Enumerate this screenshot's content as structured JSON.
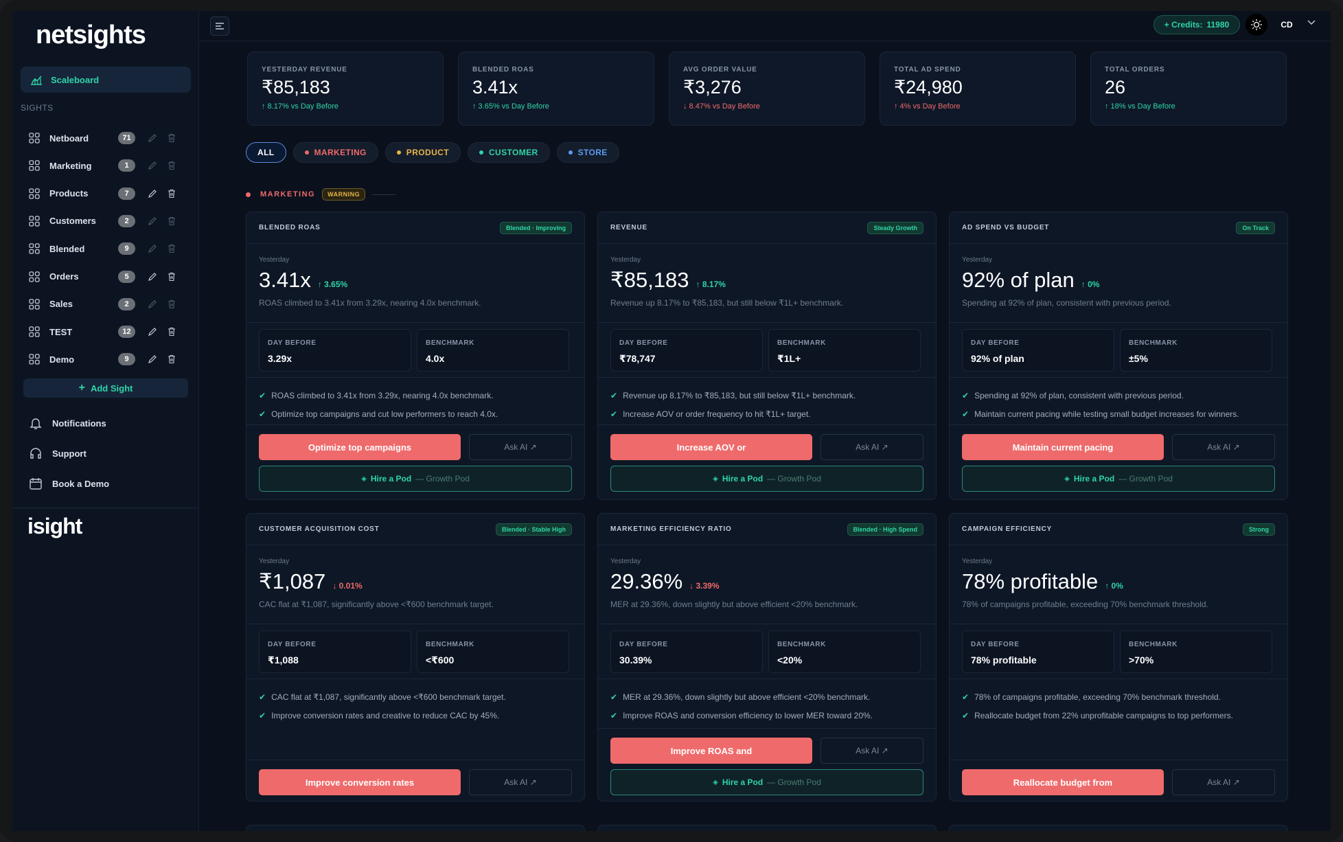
{
  "brand": {
    "logo": "netsights",
    "logo2": "isight"
  },
  "sidebar": {
    "active_item": "Scaleboard",
    "section_label": "SIGHTS",
    "sights": [
      {
        "label": "Netboard",
        "count": "71"
      },
      {
        "label": "Marketing",
        "count": "1"
      },
      {
        "label": "Products",
        "count": "7"
      },
      {
        "label": "Customers",
        "count": "2"
      },
      {
        "label": "Blended",
        "count": "9"
      },
      {
        "label": "Orders",
        "count": "5"
      },
      {
        "label": "Sales",
        "count": "2"
      },
      {
        "label": "TEST",
        "count": "12"
      },
      {
        "label": "Demo",
        "count": "9"
      }
    ],
    "add_sight": "Add Sight",
    "links": {
      "notifications": "Notifications",
      "support": "Support",
      "book_demo": "Book a Demo"
    }
  },
  "topbar": {
    "credits_label": "+ Credits:",
    "credits_value": "11980",
    "avatar": "CD"
  },
  "kpis": [
    {
      "label": "YESTERDAY REVENUE",
      "value": "₹85,183",
      "change": "↑ 8.17% vs Day Before",
      "dir": "up"
    },
    {
      "label": "BLENDED ROAS",
      "value": "3.41x",
      "change": "↑ 3.65% vs Day Before",
      "dir": "up"
    },
    {
      "label": "AVG ORDER VALUE",
      "value": "₹3,276",
      "change": "↓ 8.47% vs Day Before",
      "dir": "down"
    },
    {
      "label": "TOTAL AD SPEND",
      "value": "₹24,980",
      "change": "↑ 4% vs Day Before",
      "dir": "down"
    },
    {
      "label": "TOTAL ORDERS",
      "value": "26",
      "change": "↑ 18% vs Day Before",
      "dir": "up"
    }
  ],
  "filters": [
    {
      "label": "ALL",
      "color": "#ffffff"
    },
    {
      "label": "MARKETING",
      "color": "#ef6a6b"
    },
    {
      "label": "PRODUCT",
      "color": "#e7b44a"
    },
    {
      "label": "CUSTOMER",
      "color": "#2fd4a9"
    },
    {
      "label": "STORE",
      "color": "#5b9cf0"
    }
  ],
  "section": {
    "name": "MARKETING",
    "badge": "WARNING"
  },
  "common": {
    "yesterday": "Yesterday",
    "day_before": "DAY BEFORE",
    "benchmark": "BENCHMARK",
    "ask_ai": "Ask AI ↗",
    "hire_pod": "Hire a Pod",
    "growth_pod": "— Growth Pod"
  },
  "cards": [
    {
      "title": "BLENDED ROAS",
      "tag": "Blended · Improving",
      "value": "3.41x",
      "change": "↑ 3.65%",
      "dir": "up",
      "desc": "ROAS climbed to 3.41x from 3.29x, nearing 4.0x benchmark.",
      "day_before": "3.29x",
      "benchmark": "4.0x",
      "checks": [
        "ROAS climbed to 3.41x from 3.29x, nearing 4.0x benchmark.",
        "Optimize top campaigns and cut low performers to reach 4.0x."
      ],
      "cta": "Optimize top campaigns"
    },
    {
      "title": "REVENUE",
      "tag": "Steady Growth",
      "value": "₹85,183",
      "change": "↑ 8.17%",
      "dir": "up",
      "desc": "Revenue up 8.17% to ₹85,183, but still below ₹1L+ benchmark.",
      "day_before": "₹78,747",
      "benchmark": "₹1L+",
      "checks": [
        "Revenue up 8.17% to ₹85,183, but still below ₹1L+ benchmark.",
        "Increase AOV or order frequency to hit ₹1L+ target."
      ],
      "cta": "Increase AOV or"
    },
    {
      "title": "AD SPEND VS BUDGET",
      "tag": "On Track",
      "value": "92% of plan",
      "change": "↑ 0%",
      "dir": "up",
      "desc": "Spending at 92% of plan, consistent with previous period.",
      "day_before": "92% of plan",
      "benchmark": "±5%",
      "checks": [
        "Spending at 92% of plan, consistent with previous period.",
        "Maintain current pacing while testing small budget increases for winners."
      ],
      "cta": "Maintain current pacing"
    },
    {
      "title": "CUSTOMER ACQUISITION COST",
      "tag": "Blended · Stable High",
      "value": "₹1,087",
      "change": "↓ 0.01%",
      "dir": "down",
      "desc": "CAC flat at ₹1,087, significantly above <₹600 benchmark target.",
      "day_before": "₹1,088",
      "benchmark": "<₹600",
      "checks": [
        "CAC flat at ₹1,087, significantly above <₹600 benchmark target.",
        "Improve conversion rates and creative to reduce CAC by 45%."
      ],
      "cta": "Improve conversion rates"
    },
    {
      "title": "MARKETING EFFICIENCY RATIO",
      "tag": "Blended · High Spend",
      "value": "29.36%",
      "change": "↓ 3.39%",
      "dir": "down",
      "desc": "MER at 29.36%, down slightly but above efficient <20% benchmark.",
      "day_before": "30.39%",
      "benchmark": "<20%",
      "checks": [
        "MER at 29.36%, down slightly but above efficient <20% benchmark.",
        "Improve ROAS and conversion efficiency to lower MER toward 20%."
      ],
      "cta": "Improve ROAS and"
    },
    {
      "title": "CAMPAIGN EFFICIENCY",
      "tag": "Strong",
      "value": "78% profitable",
      "change": "↑ 0%",
      "dir": "up",
      "desc": "78% of campaigns profitable, exceeding 70% benchmark threshold.",
      "day_before": "78% profitable",
      "benchmark": ">70%",
      "checks": [
        "78% of campaigns profitable, exceeding 70% benchmark threshold.",
        "Reallocate budget from 22% unprofitable campaigns to top performers."
      ],
      "cta": "Reallocate budget from"
    }
  ],
  "colors": {
    "accent": "#2fd4a9",
    "cta": "#ef6a6b",
    "up": "#2fd4a9",
    "down": "#ef6a6b"
  }
}
